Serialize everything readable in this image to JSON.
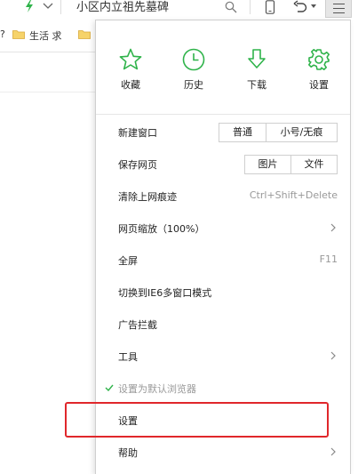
{
  "toolbar": {
    "address": "小区内立祖先墓碑",
    "icons": [
      "lightning-icon",
      "chevron-down-icon",
      "search-icon",
      "phone-icon",
      "undo-icon",
      "menu-icon"
    ]
  },
  "bookmarks": {
    "fragment": "?",
    "items": [
      {
        "label": "生活 求"
      }
    ]
  },
  "menu": {
    "quick_actions": [
      {
        "label": "收藏",
        "icon": "star-icon"
      },
      {
        "label": "历史",
        "icon": "clock-icon"
      },
      {
        "label": "下载",
        "icon": "download-icon"
      },
      {
        "label": "设置",
        "icon": "gear-icon"
      }
    ],
    "new_window": {
      "label": "新建窗口",
      "btn_normal": "普通",
      "btn_private": "小号/无痕"
    },
    "save_page": {
      "label": "保存网页",
      "btn_image": "图片",
      "btn_file": "文件"
    },
    "clear_history": {
      "label": "清除上网痕迹",
      "shortcut": "Ctrl+Shift+Delete"
    },
    "zoom": {
      "label": "网页缩放（100%）"
    },
    "fullscreen": {
      "label": "全屏",
      "shortcut": "F11"
    },
    "ie6_mode": {
      "label": "切换到IE6多窗口模式"
    },
    "adblock": {
      "label": "广告拦截"
    },
    "tools": {
      "label": "工具"
    },
    "default_browser": {
      "label": "设置为默认浏览器"
    },
    "settings": {
      "label": "设置"
    },
    "help": {
      "label": "帮助"
    }
  },
  "colors": {
    "accent_green": "#2fb34a",
    "highlight_red": "#e0272b"
  }
}
